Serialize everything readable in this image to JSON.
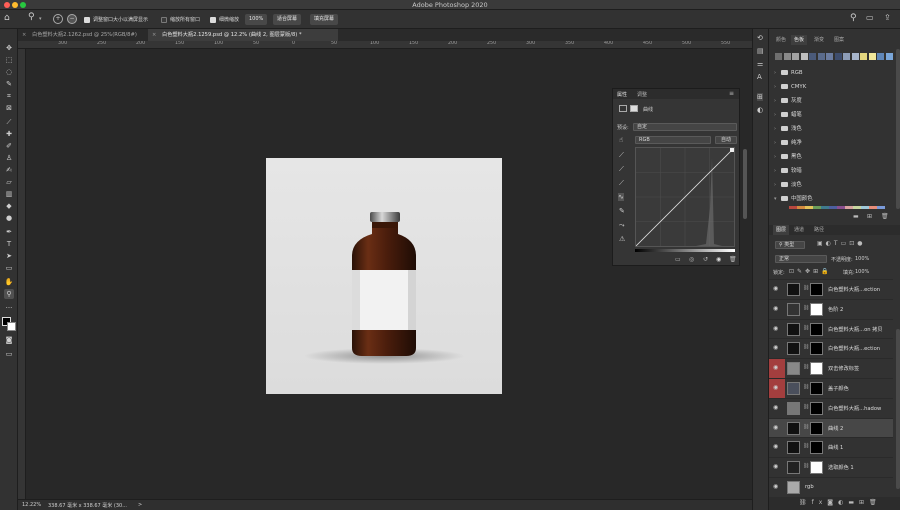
{
  "window": {
    "title": "Adobe Photoshop 2020",
    "traffic_lights": {
      "close": "#ff5f57",
      "minimize": "#febc2e",
      "zoom": "#28c840"
    }
  },
  "options_bar": {
    "zoom_tool_icon": "zoom-icon",
    "resize_windows_label": "调整窗口大小以满屏显示",
    "zoom_all_windows_label": "缩放所有窗口",
    "scrubby_zoom_label": "细微缩放",
    "zoom_percent": "100%",
    "fit_screen_label": "适合屏幕",
    "fill_screen_label": "填充屏幕",
    "checks": {
      "resize_windows": true,
      "zoom_all": false,
      "scrubby": true
    }
  },
  "tabs": [
    {
      "label": "白色塑料大瓶2.1262.psd @ 25%(RGB/8#)",
      "active": false
    },
    {
      "label": "白色塑料大瓶2.1259.psd @ 12.2% (曲线 2, 图层蒙版/8) *",
      "active": true
    }
  ],
  "ruler_ticks": [
    "300",
    "250",
    "200",
    "150",
    "100",
    "50",
    "0",
    "50",
    "100",
    "150",
    "200",
    "250",
    "300",
    "350",
    "400",
    "450",
    "500",
    "550",
    "600"
  ],
  "status": {
    "zoom": "12.22%",
    "doc_size": "338.67 毫米 x 338.67 毫米 (30...",
    "arrow": ">"
  },
  "properties": {
    "tabs": [
      "属性",
      "调整"
    ],
    "type_label": "曲线",
    "preset_label": "预设:",
    "preset_value": "自定",
    "channel_value": "RGB",
    "auto_label": "自动"
  },
  "right_panel": {
    "top_tabs": [
      "颜色",
      "色板",
      "渐变",
      "图案"
    ],
    "swatches": [
      "#6f6f6f",
      "#8a8a8a",
      "#a3a3a3",
      "#bdbdbd",
      "#4a5a7a",
      "#5a6b8c",
      "#6b7ca0",
      "#3e4d6d",
      "#8d9db8",
      "#a8b6cc",
      "#e3d67e",
      "#f1e79a",
      "#5f86b8",
      "#7aa6d9"
    ],
    "groups": [
      "RGB",
      "CMYK",
      "灰度",
      "蜡笔",
      "浅色",
      "纯净",
      "黑色",
      "较暗",
      "淡色",
      "中国颜色"
    ],
    "color_strip": [
      "#b9473f",
      "#d48a3f",
      "#e4c35a",
      "#6b9c5a",
      "#3f7a8e",
      "#4d5fa0",
      "#8a4f8f",
      "#d9a3a0",
      "#c8d6a0",
      "#a0c8d9",
      "#e88d7a",
      "#7a9ad9"
    ],
    "layer_tabs": [
      "图层",
      "通道",
      "路径"
    ],
    "filter_label": "类型",
    "blend_mode": "正常",
    "opacity_label": "不透明度:",
    "opacity_value": "100%",
    "lock_label": "锁定:",
    "fill_label": "填充:",
    "fill_value": "100%",
    "layers": [
      {
        "name": "白色塑料大瓶...ection",
        "kind": "curves",
        "selected": false,
        "red": false
      },
      {
        "name": "色阶 2",
        "kind": "levels",
        "selected": false,
        "red": false
      },
      {
        "name": "白色塑料大瓶...on 拷贝",
        "kind": "curves",
        "selected": false,
        "red": false
      },
      {
        "name": "白色塑料大瓶...ection",
        "kind": "curves",
        "selected": false,
        "red": false
      },
      {
        "name": "双击修改标签",
        "kind": "smart",
        "selected": false,
        "red": true
      },
      {
        "name": "盖子颜色",
        "kind": "fill",
        "selected": false,
        "red": true
      },
      {
        "name": "白色塑料大瓶...hadow",
        "kind": "shadow",
        "selected": false,
        "red": false
      },
      {
        "name": "曲线 2",
        "kind": "curves",
        "selected": true,
        "red": false
      },
      {
        "name": "曲线 1",
        "kind": "curves",
        "selected": false,
        "red": false
      },
      {
        "name": "选取颜色 1",
        "kind": "selective",
        "selected": false,
        "red": false
      },
      {
        "name": "rgb",
        "kind": "folder",
        "selected": false,
        "red": false
      }
    ]
  }
}
